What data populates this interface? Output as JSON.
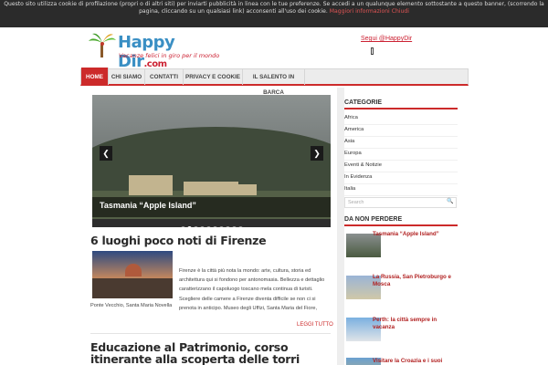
{
  "cookie": {
    "text": "Questo sito utilizza cookie di profilazione (propri o di altri siti) per inviarti pubblicità in linea con le tue preferenze. Se accedi a un qualunque elemento sottostante a questo banner, (scorrendo la pagina, cliccando su un qualsiasi link) acconsenti all'uso dei cookie.",
    "more_link": "Maggiori informazioni",
    "close_link": "Chiudi"
  },
  "header": {
    "logo_name": "Happy Dir",
    "logo_domain": ".com",
    "logo_tagline": "Vacanze felici in giro per il mondo",
    "follow_link": "Segui @HappyDir"
  },
  "nav": {
    "items": [
      {
        "label": "HOME"
      },
      {
        "label": "CHI SIAMO"
      },
      {
        "label": "CONTATTI"
      },
      {
        "label": "PRIVACY E COOKIE"
      },
      {
        "label": "IL SALENTO IN BARCA"
      }
    ]
  },
  "slider": {
    "caption": "Tasmania “Apple Island”",
    "prev_icon": "chevron-left-icon",
    "next_icon": "chevron-right-icon",
    "dot_count": 10,
    "active_dot": 1
  },
  "articles": [
    {
      "title": "6 luoghi poco noti di Firenze",
      "excerpt": "Firenze è la città più nota la mondo: arte, cultura, storia ed architettura qui si fondono per antonomasia. Bellezza e dettaglio caratterizzano il capoluogo toscano mela continua di turisti. Scegliere delle camere a Firenze diventa difficile se non ci si prenota in anticipo. Museo degli Uffizi, Santa Maria del Fiore,",
      "excerpt_tail": "Ponte Vecchio, Santa Maria Novella",
      "read_more": "LEGGI TUTTO"
    },
    {
      "title": "Educazione al Patrimonio, corso itinerante alla scoperta delle torri pugliesi"
    }
  ],
  "sidebar": {
    "categories_title": "CATEGORIE",
    "categories": [
      "Africa",
      "America",
      "Asia",
      "Europa",
      "Eventi & Notizie",
      "In Evidenza",
      "Italia"
    ],
    "search_placeholder": "Search",
    "featured_title": "DA NON PERDERE",
    "posts": [
      "Tasmania “Apple Island”",
      "La Russia, San Pietroburgo e Mosca",
      "Perth: la città sempre in vacanza",
      "Visitare la Croazia e i suoi"
    ]
  },
  "colors": {
    "accent": "#cc2a2a",
    "logo_blue": "#3a8fc4",
    "cookie_bg": "#2b2b2b"
  }
}
